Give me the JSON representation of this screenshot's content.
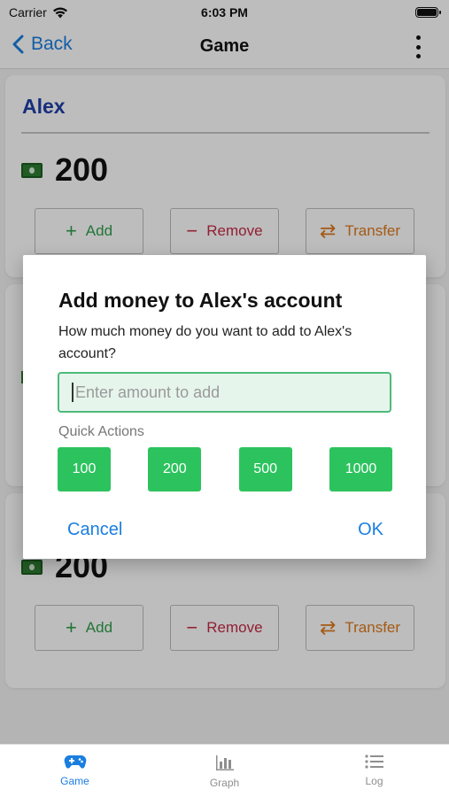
{
  "status_bar": {
    "carrier": "Carrier",
    "time": "6:03 PM"
  },
  "nav": {
    "back_label": "Back",
    "title": "Game"
  },
  "cards": [
    {
      "name": "Alex",
      "money": "200",
      "actions": {
        "add": "Add",
        "remove": "Remove",
        "transfer": "Transfer"
      }
    },
    {
      "money": "200",
      "actions": {
        "add": "Add",
        "remove": "Remove",
        "transfer": "Transfer"
      }
    }
  ],
  "dialog": {
    "title": "Add money to Alex's account",
    "message": "How much money do you want to add to Alex's account?",
    "input_placeholder": "Enter amount to add",
    "input_value": "",
    "quick_actions_label": "Quick Actions",
    "quick_amounts": [
      "100",
      "200",
      "500",
      "1000"
    ],
    "cancel_label": "Cancel",
    "ok_label": "OK"
  },
  "tabs": [
    {
      "label": "Game",
      "icon": "gamepad-icon",
      "active": true
    },
    {
      "label": "Graph",
      "icon": "bar-chart-icon",
      "active": false
    },
    {
      "label": "Log",
      "icon": "list-icon",
      "active": false
    }
  ],
  "colors": {
    "accent": "#1a7ee0",
    "player_name": "#1f3fa8",
    "add": "#2e9e4a",
    "remove": "#c62a44",
    "transfer": "#de7a1e",
    "quick_button": "#2cc35e"
  }
}
